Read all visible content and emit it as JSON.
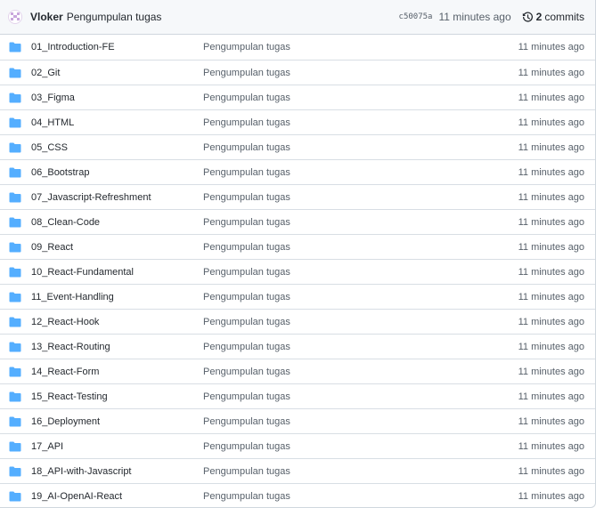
{
  "latest_commit": {
    "author": "Vloker",
    "message": "Pengumpulan tugas",
    "sha": "c50075a",
    "time": "11 minutes ago",
    "commits_count": "2",
    "commits_label": "commits"
  },
  "folder_icon_color": "#54aeff",
  "entries": [
    {
      "name": "01_Introduction-FE",
      "message": "Pengumpulan tugas",
      "age": "11 minutes ago"
    },
    {
      "name": "02_Git",
      "message": "Pengumpulan tugas",
      "age": "11 minutes ago"
    },
    {
      "name": "03_Figma",
      "message": "Pengumpulan tugas",
      "age": "11 minutes ago"
    },
    {
      "name": "04_HTML",
      "message": "Pengumpulan tugas",
      "age": "11 minutes ago"
    },
    {
      "name": "05_CSS",
      "message": "Pengumpulan tugas",
      "age": "11 minutes ago"
    },
    {
      "name": "06_Bootstrap",
      "message": "Pengumpulan tugas",
      "age": "11 minutes ago"
    },
    {
      "name": "07_Javascript-Refreshment",
      "message": "Pengumpulan tugas",
      "age": "11 minutes ago"
    },
    {
      "name": "08_Clean-Code",
      "message": "Pengumpulan tugas",
      "age": "11 minutes ago"
    },
    {
      "name": "09_React",
      "message": "Pengumpulan tugas",
      "age": "11 minutes ago"
    },
    {
      "name": "10_React-Fundamental",
      "message": "Pengumpulan tugas",
      "age": "11 minutes ago"
    },
    {
      "name": "11_Event-Handling",
      "message": "Pengumpulan tugas",
      "age": "11 minutes ago"
    },
    {
      "name": "12_React-Hook",
      "message": "Pengumpulan tugas",
      "age": "11 minutes ago"
    },
    {
      "name": "13_React-Routing",
      "message": "Pengumpulan tugas",
      "age": "11 minutes ago"
    },
    {
      "name": "14_React-Form",
      "message": "Pengumpulan tugas",
      "age": "11 minutes ago"
    },
    {
      "name": "15_React-Testing",
      "message": "Pengumpulan tugas",
      "age": "11 minutes ago"
    },
    {
      "name": "16_Deployment",
      "message": "Pengumpulan tugas",
      "age": "11 minutes ago"
    },
    {
      "name": "17_API",
      "message": "Pengumpulan tugas",
      "age": "11 minutes ago"
    },
    {
      "name": "18_API-with-Javascript",
      "message": "Pengumpulan tugas",
      "age": "11 minutes ago"
    },
    {
      "name": "19_AI-OpenAI-React",
      "message": "Pengumpulan tugas",
      "age": "11 minutes ago"
    }
  ]
}
